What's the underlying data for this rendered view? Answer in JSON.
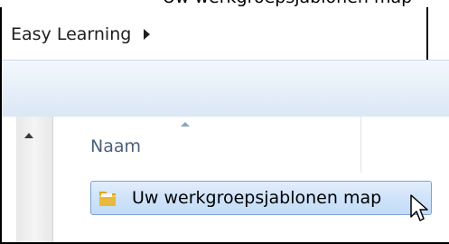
{
  "caption": "Uw werkgroepsjablonen map",
  "address_bar": {
    "breadcrumb": "Easy Learning"
  },
  "file_list": {
    "column_header": "Naam",
    "items": [
      {
        "name": "Uw werkgroepsjablonen map",
        "icon": "folder-icon",
        "selected": true
      }
    ]
  },
  "colors": {
    "toolbar": "#dae7f5",
    "selection": "#cfe3fa",
    "selection_border": "#7da2ce",
    "folder": "#e8b93f"
  }
}
